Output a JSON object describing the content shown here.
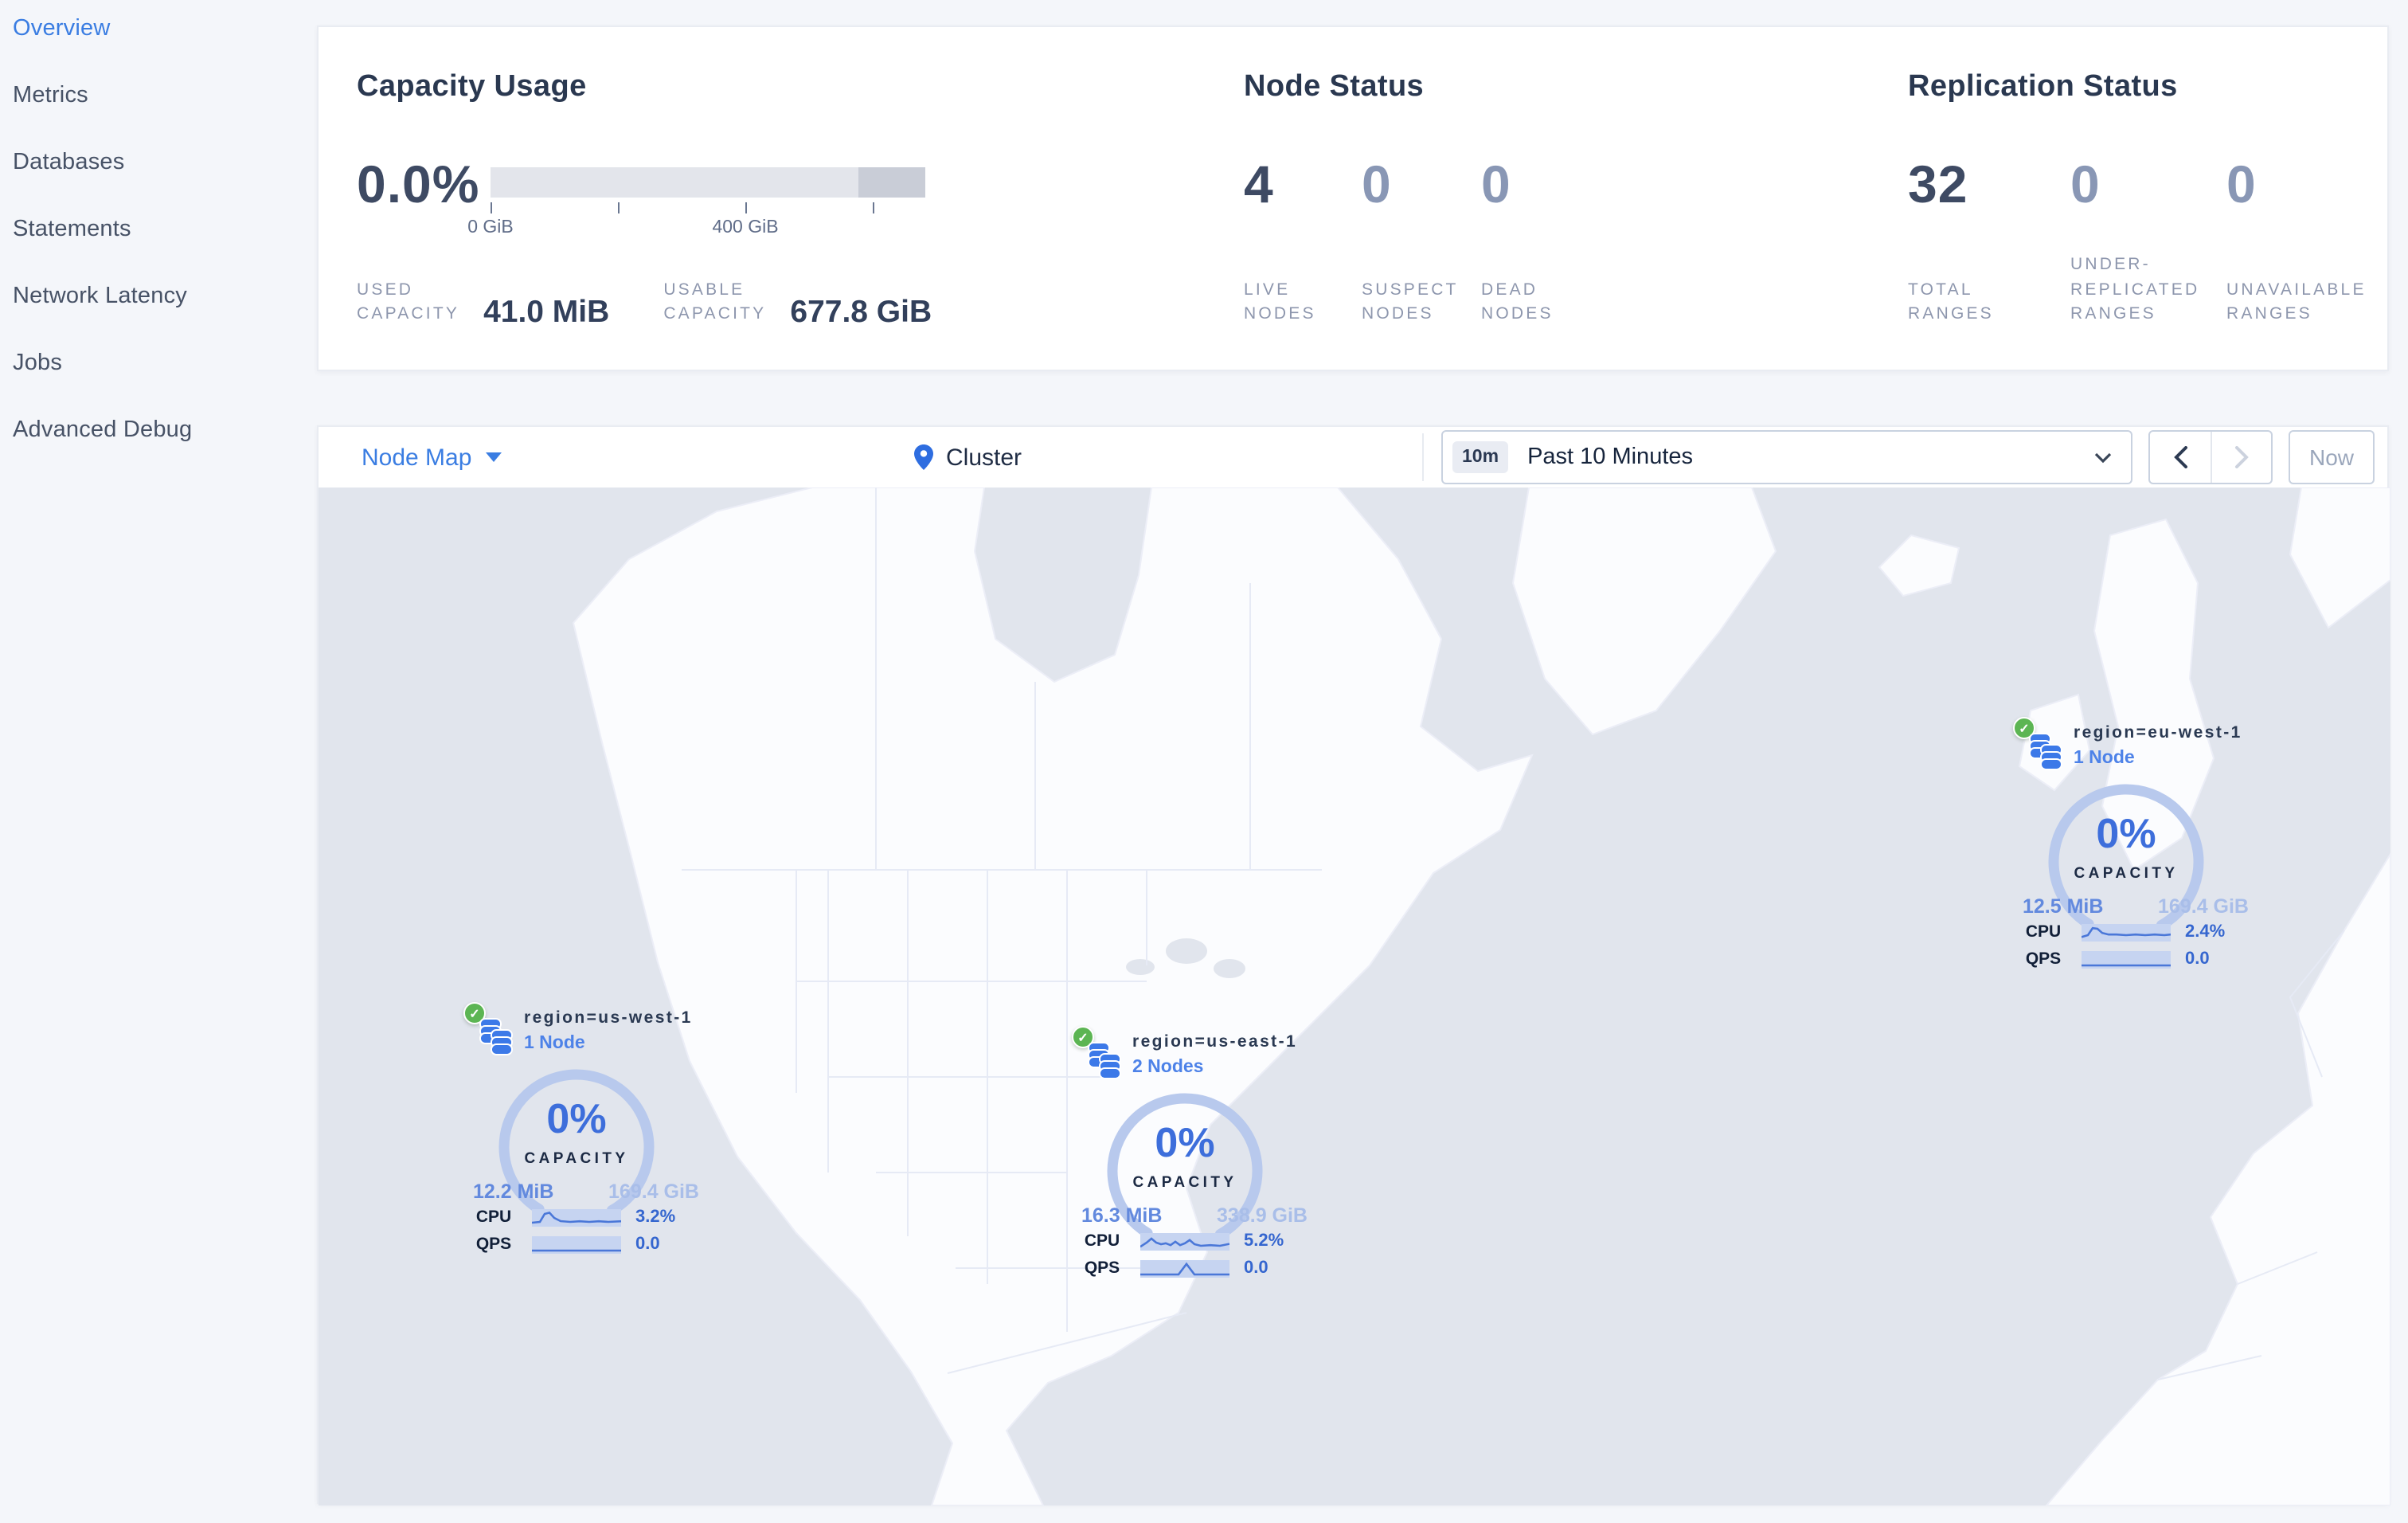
{
  "sidebar": {
    "items": [
      {
        "label": "Overview"
      },
      {
        "label": "Metrics"
      },
      {
        "label": "Databases"
      },
      {
        "label": "Statements"
      },
      {
        "label": "Network Latency"
      },
      {
        "label": "Jobs"
      },
      {
        "label": "Advanced Debug"
      }
    ]
  },
  "summary": {
    "capacity": {
      "title": "Capacity Usage",
      "percent": "0.0%",
      "tick_label_zero": "0 GiB",
      "tick_label_mid": "400 GiB",
      "stats": [
        {
          "label": "USED\nCAPACITY",
          "value": "41.0 MiB"
        },
        {
          "label": "USABLE\nCAPACITY",
          "value": "677.8 GiB"
        }
      ]
    },
    "node_status": {
      "title": "Node Status",
      "stats": [
        {
          "value": "4",
          "label": "LIVE\nNODES"
        },
        {
          "value": "0",
          "label": "SUSPECT\nNODES"
        },
        {
          "value": "0",
          "label": "DEAD\nNODES"
        }
      ]
    },
    "replication": {
      "title": "Replication Status",
      "stats": [
        {
          "value": "32",
          "label": "TOTAL\nRANGES"
        },
        {
          "value": "0",
          "label": "UNDER-\nREPLICATED\nRANGES"
        },
        {
          "value": "0",
          "label": "UNAVAILABLE\nRANGES"
        }
      ]
    }
  },
  "toolbar": {
    "view": "Node Map",
    "breadcrumb": "Cluster",
    "time_badge": "10m",
    "time_range": "Past 10 Minutes",
    "now": "Now"
  },
  "colors": {
    "accent_blue": "#3a7de2",
    "healthy_green": "#5cb553",
    "map_ocean": "#e1e5ed",
    "map_land": "#fbfcfe"
  },
  "map": {
    "regions": [
      {
        "name": "region=us-west-1",
        "nodes": "1 Node",
        "percent": "0%",
        "capacity_label": "CAPACITY",
        "used": "12.2 MiB",
        "usable": "169.4 GiB",
        "cpu_label": "CPU",
        "cpu": "3.2%",
        "qps_label": "QPS",
        "qps": "0.0",
        "cpu_spark": "0,8.5 5,8 8,3 11,2.2 14,5.5 18,7.5 24,8 30,7.6 36,8 42,7.6 48,8 56,7.6",
        "qps_spark": "0,9 56,9"
      },
      {
        "name": "region=us-east-1",
        "nodes": "2 Nodes",
        "percent": "0%",
        "capacity_label": "CAPACITY",
        "used": "16.3 MiB",
        "usable": "338.9 GiB",
        "cpu_label": "CPU",
        "cpu": "5.2%",
        "qps_label": "QPS",
        "qps": "0.0",
        "cpu_spark": "0,8.6 4,6 7,3.5 10,6 13,7 16,6.4 19,7.6 22,5.4 25,7.6 28,6.4 31,4.4 34,7 38,8 44,7.6 50,8 56,6.8",
        "qps_spark": "0,9 24,9 29,2.4 34,9 56,9"
      },
      {
        "name": "region=eu-west-1",
        "nodes": "1 Node",
        "percent": "0%",
        "capacity_label": "CAPACITY",
        "used": "12.5 MiB",
        "usable": "169.4 GiB",
        "cpu_label": "CPU",
        "cpu": "2.4%",
        "qps_label": "QPS",
        "qps": "0.0",
        "cpu_spark": "0,8.2 4,7 7,2.6 10,3 13,5.6 17,6.6 22,6.6 28,7 34,6.6 40,7 46,6.6 52,7 56,6.6",
        "qps_spark": "0,9 56,9"
      }
    ]
  }
}
